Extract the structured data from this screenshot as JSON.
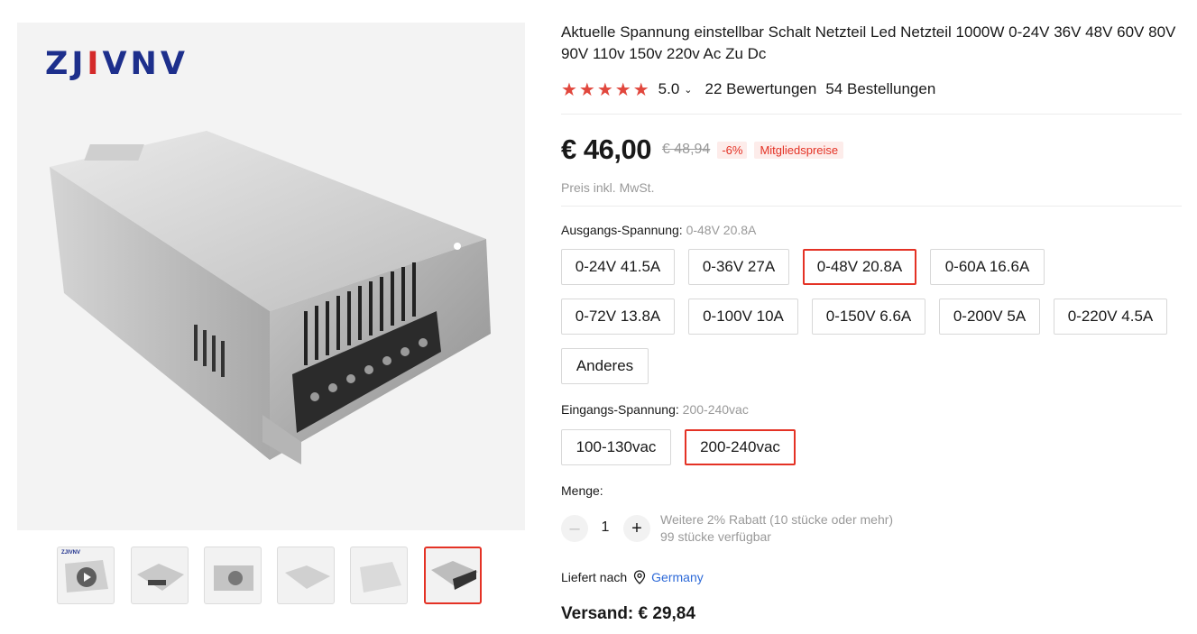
{
  "brand": {
    "part1": "ZJ",
    "part2": "I",
    "part3": "VNV"
  },
  "product": {
    "title": "Aktuelle Spannung einstellbar Schalt Netzteil Led Netzteil 1000W 0-24V 36V 48V 60V 80V 90V 110v 150v 220v Ac Zu Dc",
    "rating": "5.0",
    "reviews": "22 Bewertungen",
    "orders": "54 Bestellungen",
    "stars": "★★★★★"
  },
  "price": {
    "current": "€ 46,00",
    "old": "€ 48,94",
    "discount": "-6%",
    "member_label": "Mitgliedspreise",
    "tax_note": "Preis inkl. MwSt."
  },
  "output_voltage": {
    "label": "Ausgangs-Spannung: ",
    "selected": "0-48V 20.8A",
    "options": [
      "0-24V 41.5A",
      "0-36V 27A",
      "0-48V 20.8A",
      "0-60A 16.6A",
      "0-72V 13.8A",
      "0-100V 10A",
      "0-150V 6.6A",
      "0-200V 5A",
      "0-220V 4.5A",
      "Anderes"
    ]
  },
  "input_voltage": {
    "label": "Eingangs-Spannung: ",
    "selected": "200-240vac",
    "options": [
      "100-130vac",
      "200-240vac"
    ]
  },
  "quantity": {
    "label": "Menge:",
    "value": "1",
    "minus": "–",
    "plus": "+",
    "discount_note": "Weitere 2% Rabatt (10 stücke oder mehr)",
    "stock_note": "99 stücke verfügbar"
  },
  "delivery": {
    "label": "Liefert nach",
    "country": "Germany",
    "shipping": "Versand: € 29,84"
  },
  "thumbnails": [
    "video-thumbnail",
    "thumb-2",
    "thumb-3",
    "thumb-4",
    "thumb-5",
    "thumb-6"
  ],
  "colors": {
    "accent": "#e43225",
    "star": "#e1473d",
    "link": "#2e6ad8",
    "brand_blue": "#1d2f8c"
  }
}
